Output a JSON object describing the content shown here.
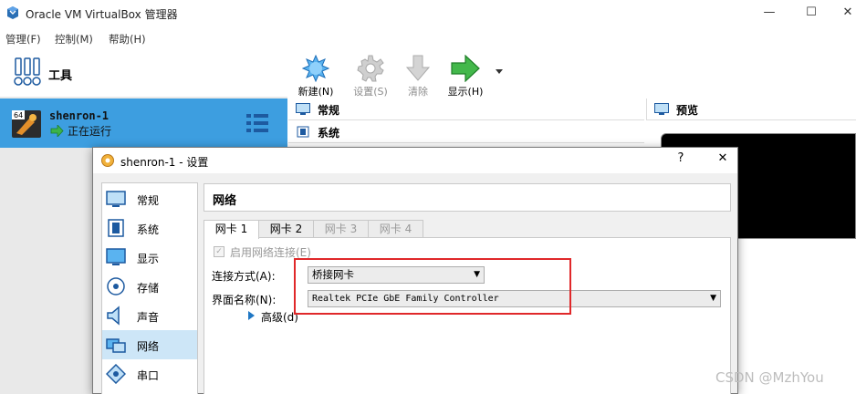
{
  "window": {
    "title": "Oracle VM VirtualBox 管理器",
    "minimize": "—",
    "maximize": "☐",
    "close": "✕"
  },
  "menu": [
    "管理(F)",
    "控制(M)",
    "帮助(H)"
  ],
  "left": {
    "tools_label": "工具",
    "vm": {
      "name": "shenron-1",
      "badge": "64",
      "state": "正在运行"
    }
  },
  "toolbar": {
    "new": "新建(N)",
    "settings": "设置(S)",
    "discard": "清除",
    "show": "显示(H)"
  },
  "details": {
    "general": "常规",
    "system": "系统",
    "preview": "预览"
  },
  "dialog": {
    "title": "shenron-1 - 设置",
    "help": "?",
    "close": "✕",
    "nav": [
      "常规",
      "系统",
      "显示",
      "存储",
      "声音",
      "网络",
      "串口"
    ],
    "page_title": "网络",
    "tabs": [
      "网卡 1",
      "网卡 2",
      "网卡 3",
      "网卡 4"
    ],
    "enable_adapter": "启用网络连接(E)",
    "attached_label": "连接方式(A):",
    "attached_value": "桥接网卡",
    "name_label": "界面名称(N):",
    "name_value": "Realtek PCIe GbE Family Controller",
    "advanced": "高级(d)"
  },
  "watermark": "CSDN @MzhYou",
  "colors": {
    "selection": "#3d9ee0",
    "nav_active": "#cde6f7",
    "highlight": "#e0282a"
  }
}
